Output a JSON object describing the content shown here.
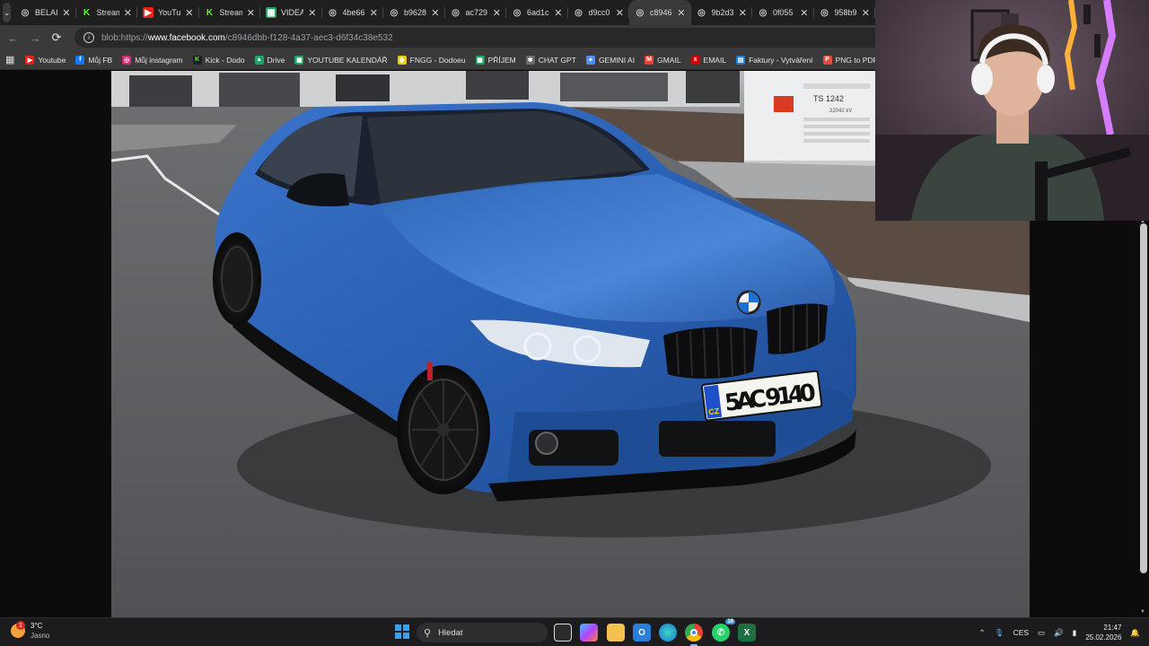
{
  "tabs": [
    {
      "title": "BELAI",
      "favicon": "globe-icon",
      "active": false
    },
    {
      "title": "Stream",
      "favicon": "kick-icon",
      "active": false
    },
    {
      "title": "YouTu",
      "favicon": "youtube-icon",
      "active": false
    },
    {
      "title": "Stream",
      "favicon": "kick-icon",
      "active": false
    },
    {
      "title": "VIDEA",
      "favicon": "sheets-icon",
      "active": false
    },
    {
      "title": "4be66",
      "favicon": "globe-icon",
      "active": false
    },
    {
      "title": "b9628",
      "favicon": "globe-icon",
      "active": false
    },
    {
      "title": "ac729",
      "favicon": "globe-icon",
      "active": false
    },
    {
      "title": "6ad1c",
      "favicon": "globe-icon",
      "active": false
    },
    {
      "title": "d9cc0",
      "favicon": "globe-icon",
      "active": false
    },
    {
      "title": "c8946",
      "favicon": "globe-icon",
      "active": true
    },
    {
      "title": "9b2d3",
      "favicon": "globe-icon",
      "active": false
    },
    {
      "title": "0f055",
      "favicon": "globe-icon",
      "active": false
    },
    {
      "title": "958b9",
      "favicon": "globe-icon",
      "active": false
    }
  ],
  "address": {
    "prefix": "blob:https://",
    "domain": "www.facebook.com",
    "path": "/c8946dbb-f128-4a37-aec3-d6f34c38e532"
  },
  "bookmarks": [
    {
      "label": "Youtube",
      "icon": "youtube-icon",
      "color": "#e62117"
    },
    {
      "label": "Můj FB",
      "icon": "facebook-icon",
      "color": "#1877f2"
    },
    {
      "label": "Můj instagram",
      "icon": "instagram-icon",
      "color": "#d62976"
    },
    {
      "label": "Kick - Dodo",
      "icon": "kick-icon",
      "color": "#1f1f1f"
    },
    {
      "label": "Drive",
      "icon": "drive-icon",
      "color": "#1fa463"
    },
    {
      "label": "YOUTUBE KALENDÁŘ",
      "icon": "sheets-icon",
      "color": "#1fa463"
    },
    {
      "label": "FNGG - Dodoeu",
      "icon": "fngg-icon",
      "color": "#f5c518"
    },
    {
      "label": "PŘÍJEM",
      "icon": "sheets-icon",
      "color": "#1fa463"
    },
    {
      "label": "CHAT GPT",
      "icon": "chatgpt-icon",
      "color": "#6b6b6b"
    },
    {
      "label": "GEMINI AI",
      "icon": "gemini-icon",
      "color": "#4f8ef7"
    },
    {
      "label": "GMAIL",
      "icon": "gmail-icon",
      "color": "#ea4335"
    },
    {
      "label": "EMAIL",
      "icon": "seznam-icon",
      "color": "#cc0000"
    },
    {
      "label": "Faktury - Vytváření",
      "icon": "invoice-icon",
      "color": "#1e7fd1"
    },
    {
      "label": "PNG to PDF",
      "icon": "pdf-icon",
      "color": "#e44c3c"
    }
  ],
  "photo": {
    "plate_country": "CZ",
    "plate_number": "5AC 9140",
    "substation_label": "TS 1242",
    "substation_sub": "22042 kV"
  },
  "taskbar": {
    "weather_temp": "3°C",
    "weather_desc": "Jasno",
    "weather_badge": "1",
    "search_placeholder": "Hledat",
    "whatsapp_badge": "19",
    "language": "CES",
    "time": "21:47",
    "date": "25.02.2026"
  },
  "colors": {
    "car_blue": "#2b63b8",
    "tab_bg": "#1f1f1f",
    "toolbar_bg": "#3a3a3a"
  }
}
